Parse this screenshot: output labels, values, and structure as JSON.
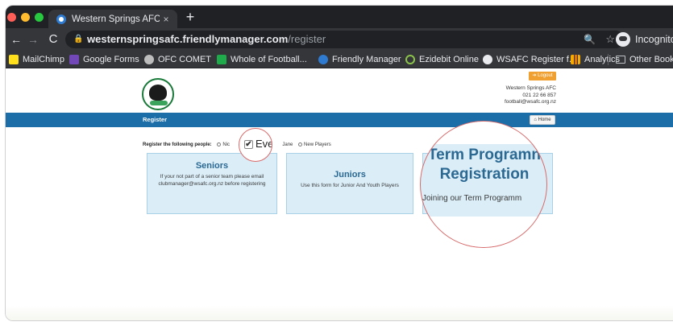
{
  "browser": {
    "tab": {
      "title": "Western Springs AFC | Registe",
      "close": "×"
    },
    "new_tab": "+",
    "nav": {
      "back": "←",
      "forward": "→",
      "reload": "C"
    },
    "url": {
      "lock": "🔒",
      "host": "westernspringsafc.friendlymanager.com",
      "path": "/register"
    },
    "zoom_icon": "🔍",
    "star_icon": "☆",
    "incognito_label": "Incognito",
    "bookmarks": [
      "MailChimp",
      "Google Forms",
      "OFC COMET",
      "Whole of Football...",
      "Friendly Manager",
      "Ezidebit Online",
      "WSAFC Register f...",
      "Analytics",
      "Other Bookma"
    ]
  },
  "site": {
    "logout": "➔ Logout",
    "club": {
      "name": "Western Springs AFC",
      "phone": "021 22 66 857",
      "email": "football@wsafc.org.nz"
    },
    "page_title": "Register",
    "home_button": "⌂ Home",
    "register_label": "Register the following people:",
    "people": {
      "first": "Nic",
      "third": "Jane",
      "new_players": "New Players"
    },
    "cards": {
      "seniors": {
        "title": "Seniors",
        "desc": "If your not part of a senior team please email clubmanager@wsafc.org.nz before registering"
      },
      "juniors": {
        "title": "Juniors",
        "desc": "Use this form for Junior And Youth Players"
      },
      "term": {
        "title_line1": "Term Programn",
        "title_line2": "Registration",
        "desc": "Joining our Term Programm"
      }
    },
    "magnified_check": {
      "mark": "✔",
      "text": "Eve"
    }
  }
}
